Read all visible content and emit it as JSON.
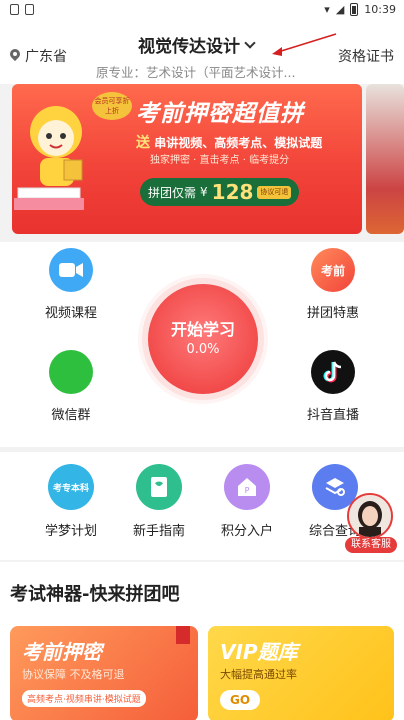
{
  "status_bar": {
    "time": "10:39"
  },
  "header": {
    "location": "广东省",
    "major_title": "视觉传达设计",
    "original_major": "原专业：艺术设计（平面艺术设计...",
    "cert_link": "资格证书"
  },
  "banner": {
    "tag": "会员可享折上折",
    "title": "考前押密超值拼",
    "send_prefix": "送",
    "send_text": "串讲视频、高频考点、模拟试题",
    "sub": "独家押密 · 直击考点 · 临考提分",
    "price_prefix": "拼团仅需",
    "price_currency": "¥",
    "price": "128",
    "price_badge": "协议可退"
  },
  "quick": {
    "video_course": "视频课程",
    "group_deal": "拼团特惠",
    "group_deal_icon_text": "考前",
    "wechat_group": "微信群",
    "douyin_live": "抖音直播",
    "start_label": "开始学习",
    "progress": "0.0%"
  },
  "grid2": {
    "dream_plan": "学梦计划",
    "dream_plan_icon_text": "考专本科",
    "newbie_guide": "新手指南",
    "points_entry": "积分入户",
    "comprehensive": "综合查询"
  },
  "customer_service": "联系客服",
  "section": {
    "title": "考试神器-快来拼团吧",
    "card1_title": "考前押密",
    "card1_sub": "协议保障 不及格可退",
    "card1_pill": "高频考点·视频串讲·模拟试题",
    "card2_title": "VIP题库",
    "card2_sub": "大幅提高通过率",
    "card2_go": "GO"
  },
  "colors": {
    "accent_red": "#e53b3b",
    "video_blue": "#3fa9f5",
    "wechat_green": "#2fbf3f",
    "douyin_black": "#111111"
  }
}
